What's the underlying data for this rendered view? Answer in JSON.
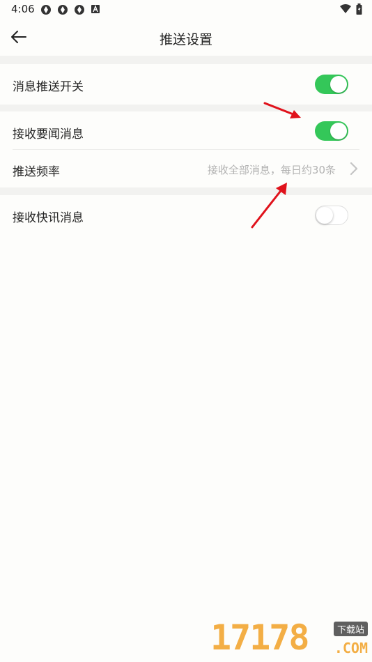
{
  "status_bar": {
    "time": "4:06",
    "left_icons": [
      "aperture-icon",
      "aperture-icon",
      "aperture-icon",
      "a-box-icon"
    ],
    "right_icons": [
      "wifi-icon",
      "battery-icon"
    ]
  },
  "header": {
    "back_icon": "arrow-left-icon",
    "title": "推送设置"
  },
  "settings": {
    "push_switch": {
      "label": "消息推送开关",
      "enabled": true
    },
    "headline_news": {
      "label": "接收要闻消息",
      "enabled": true
    },
    "push_frequency": {
      "label": "推送频率",
      "value": "接收全部消息，每日约30条",
      "icon": "chevron-right-icon"
    },
    "flash_news": {
      "label": "接收快讯消息",
      "enabled": false
    }
  },
  "watermark": {
    "brand": "17178",
    "tag": "下载站",
    "domain": ".COM"
  },
  "colors": {
    "toggle_on": "#34c759",
    "annotation_arrow": "#e0121b",
    "value_text": "#b2b2b2"
  }
}
